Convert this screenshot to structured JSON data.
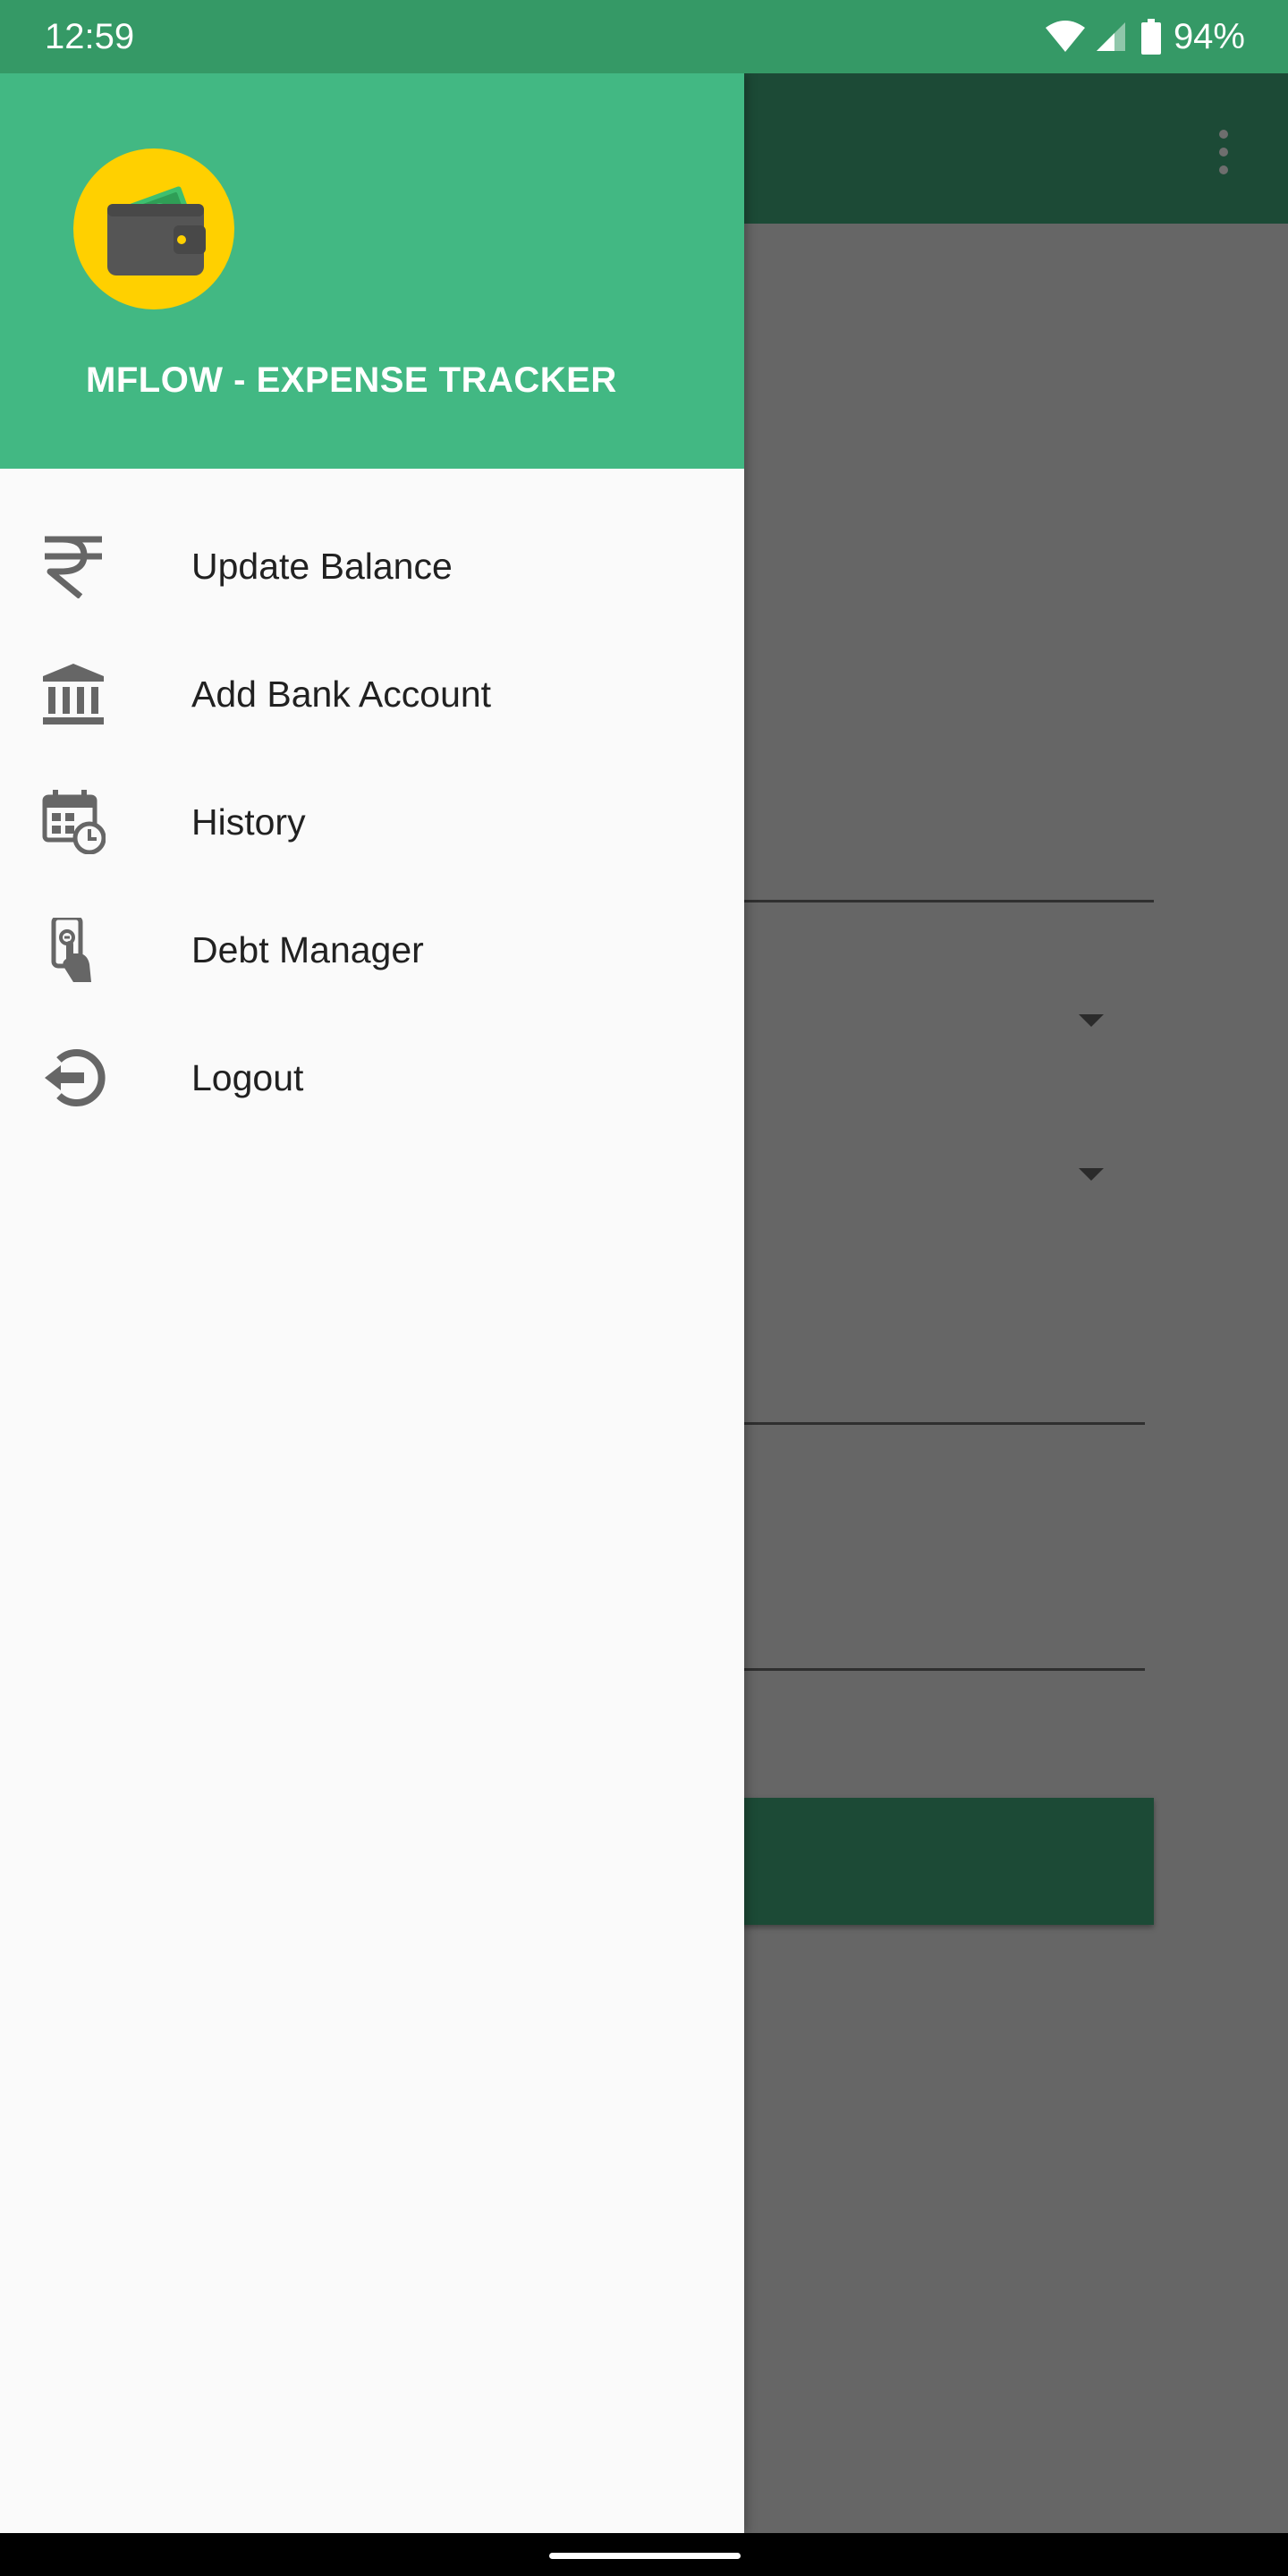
{
  "status_bar": {
    "time": "12:59",
    "battery_percent": "94%",
    "icons": [
      "wifi-icon",
      "cellular-signal-icon",
      "battery-icon"
    ]
  },
  "drawer": {
    "app_title": "MFLOW - EXPENSE TRACKER",
    "logo_icon": "wallet-icon",
    "items": [
      {
        "label": "Update Balance",
        "icon": "rupee-icon"
      },
      {
        "label": "Add Bank Account",
        "icon": "bank-icon"
      },
      {
        "label": "History",
        "icon": "calendar-clock-icon"
      },
      {
        "label": "Debt Manager",
        "icon": "hand-phone-money-icon"
      },
      {
        "label": "Logout",
        "icon": "logout-icon"
      }
    ]
  },
  "background_screen": {
    "overflow_icon": "more-vert-icon",
    "dropdown_icons": [
      "dropdown-arrow-icon",
      "dropdown-arrow-icon"
    ]
  },
  "colors": {
    "status_bar": "#359966",
    "drawer_header": "#42b883",
    "app_bar_dimmed": "#1c4a36",
    "logo_circle": "#ffd000",
    "scrim": "#666666",
    "menu_icon": "#666666",
    "menu_text": "#212121"
  }
}
